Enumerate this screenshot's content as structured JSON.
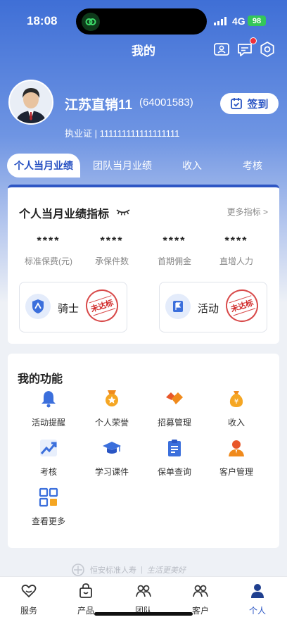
{
  "status_bar": {
    "time": "18:08",
    "network": "4G",
    "battery": "98"
  },
  "header": {
    "title": "我的"
  },
  "profile": {
    "name": "江苏直销11",
    "id": "(64001583)",
    "license": "执业证 | 111111111111111111",
    "checkin_label": "签到"
  },
  "tabs": [
    {
      "label": "个人当月业绩"
    },
    {
      "label": "团队当月业绩"
    },
    {
      "label": "收入"
    },
    {
      "label": "考核"
    }
  ],
  "performance": {
    "title": "个人当月业绩指标",
    "more_label": "更多指标 >",
    "metrics": [
      {
        "value": "****",
        "label": "标准保费(元)"
      },
      {
        "value": "****",
        "label": "承保件数"
      },
      {
        "value": "****",
        "label": "首期佣金"
      },
      {
        "value": "****",
        "label": "直增人力"
      }
    ],
    "status_boxes": [
      {
        "label": "骑士",
        "stamp": "未达标"
      },
      {
        "label": "活动",
        "stamp": "未达标"
      }
    ]
  },
  "functions": {
    "title": "我的功能",
    "items": [
      {
        "label": "活动提醒",
        "icon": "bell-icon"
      },
      {
        "label": "个人荣誉",
        "icon": "medal-icon"
      },
      {
        "label": "招募管理",
        "icon": "handshake-icon"
      },
      {
        "label": "收入",
        "icon": "money-bag-icon"
      },
      {
        "label": "考核",
        "icon": "trend-chart-icon"
      },
      {
        "label": "学习课件",
        "icon": "graduation-cap-icon"
      },
      {
        "label": "保单查询",
        "icon": "clipboard-icon"
      },
      {
        "label": "客户管理",
        "icon": "customer-icon"
      },
      {
        "label": "查看更多",
        "icon": "grid-more-icon"
      }
    ]
  },
  "footer": {
    "logo_text": "恒安标准人寿",
    "slogan": "生活更美好"
  },
  "bottom_nav": [
    {
      "label": "服务"
    },
    {
      "label": "产品"
    },
    {
      "label": "团队"
    },
    {
      "label": "客户"
    },
    {
      "label": "个人"
    }
  ],
  "colors": {
    "primary": "#2a55c4",
    "stamp": "#d02828",
    "orange": "#f08a1c"
  }
}
